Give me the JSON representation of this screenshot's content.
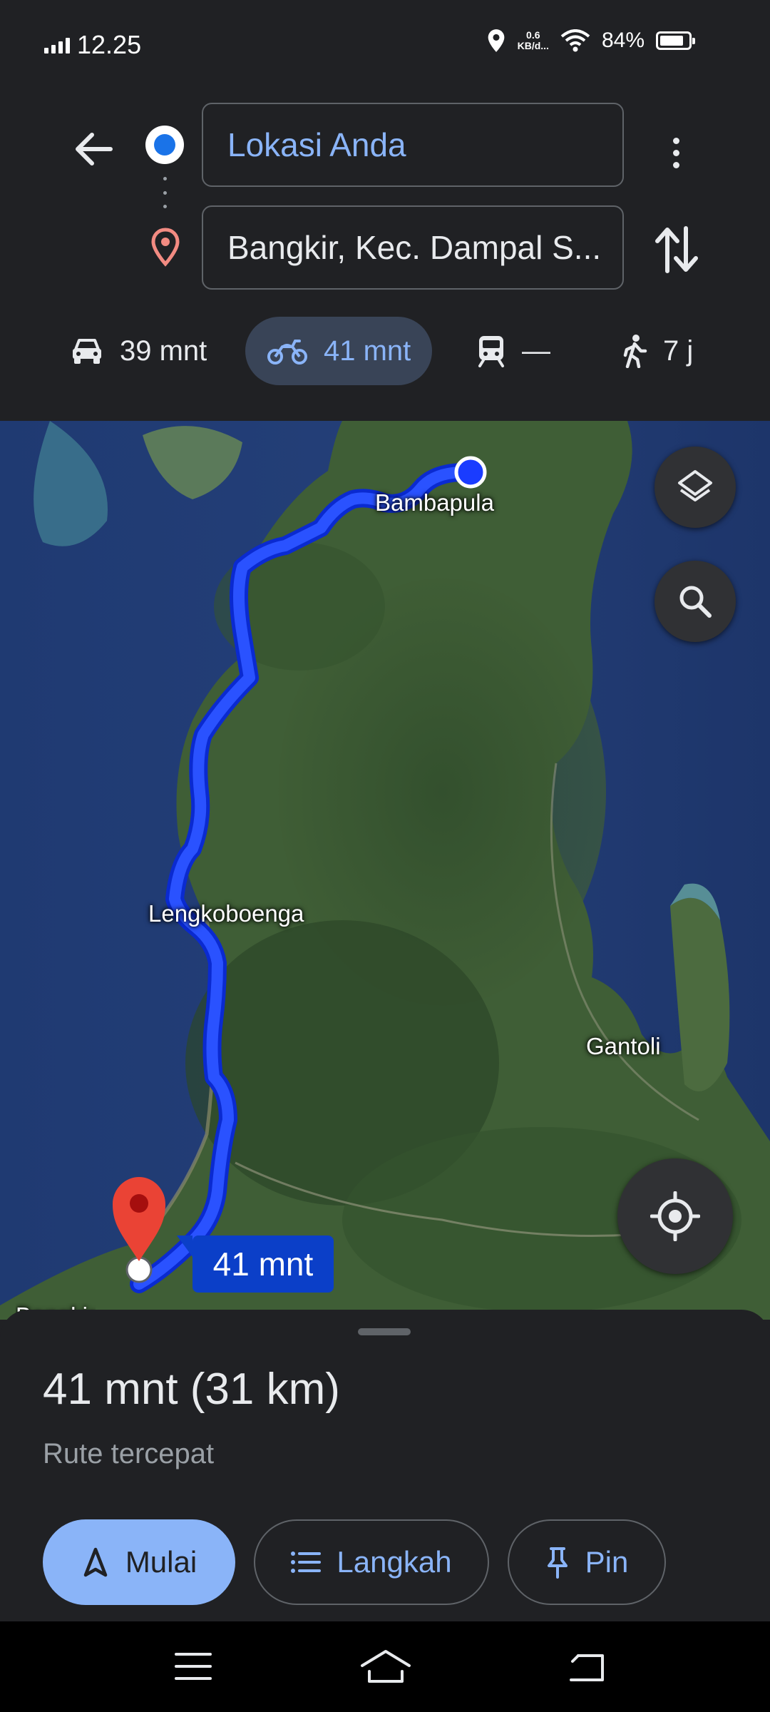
{
  "status_bar": {
    "time": "12.25",
    "net_speed_value": "0.6",
    "net_speed_unit": "KB/d...",
    "battery_percent": "84%",
    "battery_level": 0.84,
    "icons": [
      "signal-icon",
      "location-icon",
      "wifi-icon",
      "battery-icon"
    ]
  },
  "directions": {
    "origin": "Lokasi Anda",
    "destination": "Bangkir, Kec. Dampal S...",
    "icons": [
      "back-arrow-icon",
      "origin-dot-icon",
      "destination-pin-icon",
      "more-vert-icon",
      "swap-icon"
    ]
  },
  "modes": [
    {
      "name": "car",
      "icon": "car-icon",
      "label": "39 mnt",
      "selected": false
    },
    {
      "name": "motorcycle",
      "icon": "motorcycle-icon",
      "label": "41 mnt",
      "selected": true
    },
    {
      "name": "transit",
      "icon": "train-icon",
      "label": "—",
      "selected": false
    },
    {
      "name": "walk",
      "icon": "walk-icon",
      "label": "7 j",
      "selected": false
    }
  ],
  "map": {
    "labels": {
      "start": "Bambapula",
      "mid": "Lengkoboenga",
      "east": "Gantoli",
      "end_partial": "Bangkir"
    },
    "route_eta": "41 mnt",
    "route_color": "#1a3cff",
    "buttons": [
      "layers-icon",
      "search-icon",
      "my-location-icon"
    ]
  },
  "sheet": {
    "summary": "41 mnt (31 km)",
    "description": "Rute tercepat",
    "actions": {
      "start": "Mulai",
      "steps": "Langkah",
      "pin": "Pin"
    },
    "accent": "#8ab4f8"
  },
  "nav_bar": {
    "icons": [
      "menu-icon",
      "home-icon",
      "back-icon"
    ]
  }
}
